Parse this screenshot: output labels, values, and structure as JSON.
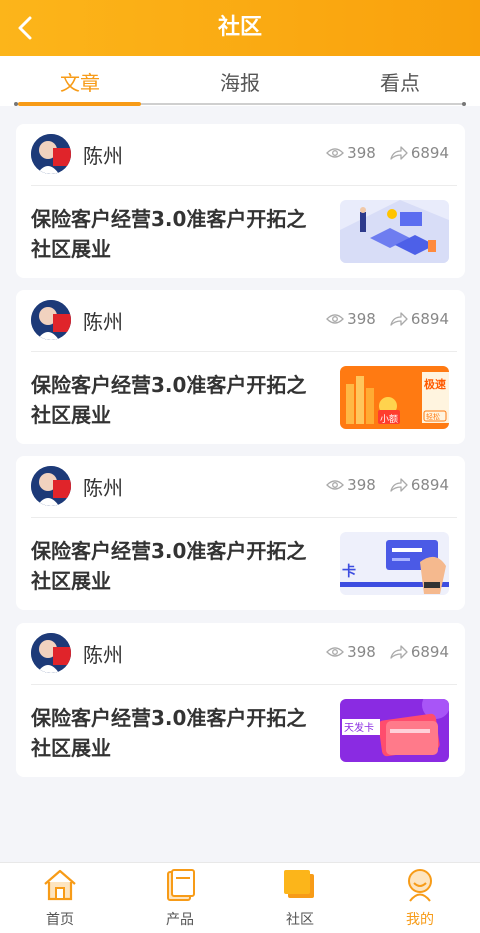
{
  "header": {
    "title": "社区"
  },
  "tabs": [
    {
      "label": "文章",
      "active": true
    },
    {
      "label": "海报",
      "active": false
    },
    {
      "label": "看点",
      "active": false
    }
  ],
  "articles": [
    {
      "author": "陈州",
      "views": "398",
      "shares": "6894",
      "title": "保险客户经营3.0准客户开拓之社区展业",
      "thumb": "isometric-office-illustration"
    },
    {
      "author": "陈州",
      "views": "398",
      "shares": "6894",
      "title": "保险客户经营3.0准客户开拓之社区展业",
      "thumb": "orange-promo-banner",
      "thumb_text": {
        "a": "极速",
        "b": "小额",
        "c": "轻松"
      }
    },
    {
      "author": "陈州",
      "views": "398",
      "shares": "6894",
      "title": "保险客户经营3.0准客户开拓之社区展业",
      "thumb": "credit-card-hand-illustration",
      "thumb_text": {
        "a": "卡"
      }
    },
    {
      "author": "陈州",
      "views": "398",
      "shares": "6894",
      "title": "保险客户经营3.0准客户开拓之社区展业",
      "thumb": "purple-card-banner",
      "thumb_text": {
        "a": "天发卡"
      }
    }
  ],
  "bottom_nav": [
    {
      "label": "首页",
      "icon": "home-icon",
      "active": false
    },
    {
      "label": "产品",
      "icon": "product-icon",
      "active": false
    },
    {
      "label": "社区",
      "icon": "community-icon",
      "active": false
    },
    {
      "label": "我的",
      "icon": "profile-icon",
      "active": true
    }
  ],
  "colors": {
    "accent": "#f79b17",
    "header": "#fcb51a"
  }
}
